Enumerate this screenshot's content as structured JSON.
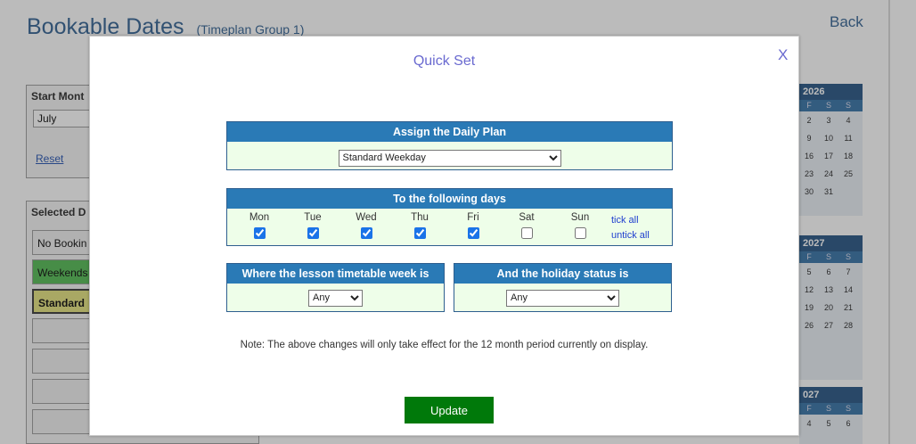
{
  "background": {
    "title": "Bookable Dates",
    "subtitle": "(Timeplan Group 1)",
    "back_link": "Back",
    "start_month_panel": {
      "title": "Start Mont",
      "select_value": "July",
      "reset_link": "Reset"
    },
    "selected_panel": {
      "title": "Selected D",
      "items": [
        "No Bookin",
        "Weekends",
        "Standard"
      ]
    },
    "calendars": [
      {
        "header": "2026",
        "day_headers": [
          "F",
          "S",
          "S"
        ],
        "rows": [
          [
            "2",
            "3",
            "4"
          ],
          [
            "9",
            "10",
            "11"
          ],
          [
            "16",
            "17",
            "18"
          ],
          [
            "23",
            "24",
            "25"
          ],
          [
            "30",
            "31",
            ""
          ]
        ]
      },
      {
        "header": "2027",
        "day_headers": [
          "F",
          "S",
          "S"
        ],
        "rows": [
          [
            "5",
            "6",
            "7"
          ],
          [
            "12",
            "13",
            "14"
          ],
          [
            "19",
            "20",
            "21"
          ],
          [
            "26",
            "27",
            "28"
          ]
        ]
      },
      {
        "header": "027",
        "day_headers": [
          "F",
          "S",
          "S"
        ],
        "rows": [
          [
            "4",
            "5",
            "6"
          ]
        ]
      }
    ]
  },
  "modal": {
    "title": "Quick Set",
    "close_label": "X",
    "daily_plan": {
      "header": "Assign the Daily Plan",
      "selected": "Standard Weekday"
    },
    "days_section": {
      "header": "To the following days",
      "days": [
        {
          "label": "Mon",
          "checked": true
        },
        {
          "label": "Tue",
          "checked": true
        },
        {
          "label": "Wed",
          "checked": true
        },
        {
          "label": "Thu",
          "checked": true
        },
        {
          "label": "Fri",
          "checked": true
        },
        {
          "label": "Sat",
          "checked": false
        },
        {
          "label": "Sun",
          "checked": false
        }
      ],
      "tick_all": "tick all",
      "untick_all": "untick all"
    },
    "timetable_week": {
      "header": "Where the lesson timetable week is",
      "selected": "Any"
    },
    "holiday_status": {
      "header": "And the holiday status is",
      "selected": "Any"
    },
    "note": "Note: The above changes will only take effect for the 12 month period currently on display.",
    "update_button": "Update"
  },
  "colors": {
    "section_header": "#2a7ab6",
    "section_body": "#eefee9",
    "title_accent": "#6a6ad0",
    "update_button": "#00790a",
    "link": "#1f3fcf"
  }
}
